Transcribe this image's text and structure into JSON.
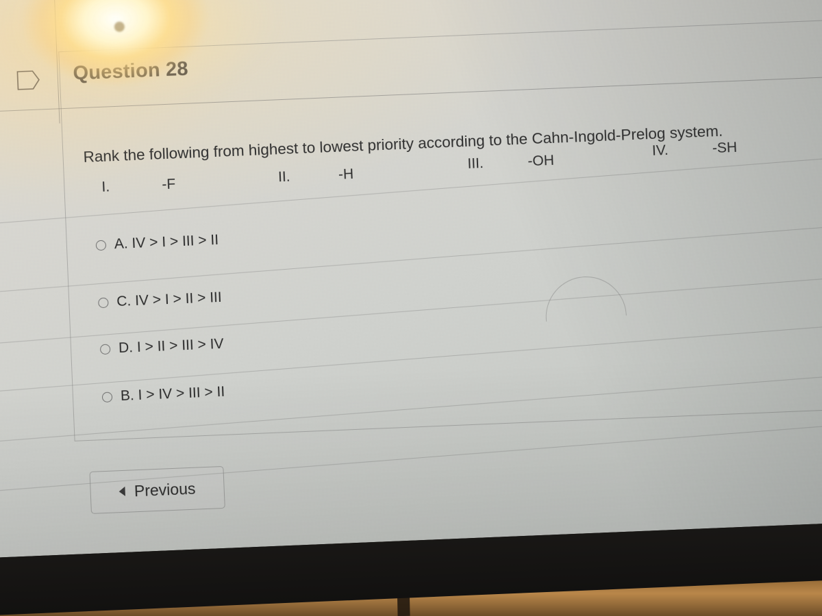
{
  "header": {
    "question_label": "Question 28",
    "flag_icon": "flag-tag-icon"
  },
  "question": {
    "prompt": "Rank the following from highest to lowest priority according to the Cahn-Ingold-Prelog system.",
    "substituents": [
      {
        "numeral": "I.",
        "group": "-F"
      },
      {
        "numeral": "II.",
        "group": "-H"
      },
      {
        "numeral": "III.",
        "group": "-OH"
      },
      {
        "numeral": "IV.",
        "group": "-SH"
      }
    ],
    "options": [
      {
        "letter": "A.",
        "text": "A. IV > I > III > II",
        "selected": false
      },
      {
        "letter": "C.",
        "text": "C. IV > I > II > III",
        "selected": false
      },
      {
        "letter": "D.",
        "text": "D. I > II > III > IV",
        "selected": false
      },
      {
        "letter": "B.",
        "text": "B. I > IV > III > II",
        "selected": false
      }
    ]
  },
  "footer": {
    "previous_label": "Previous",
    "previous_icon": "triangle-left-icon"
  },
  "colors": {
    "screen_background": "#d5d4ce",
    "text": "#2f2f2f",
    "rule": "#6e6e6e",
    "bezel": "#1b1917",
    "glare": "#fff6ce",
    "desk": "#b9874a"
  }
}
